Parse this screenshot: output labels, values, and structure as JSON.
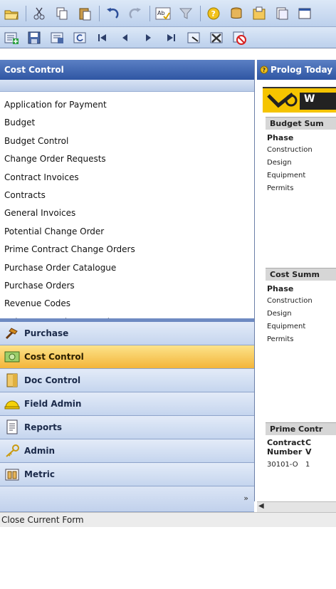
{
  "toolbar1": {
    "icons": [
      "open-folder-icon",
      "cut-icon",
      "copy-icon",
      "paste-icon",
      "undo-icon",
      "redo-icon",
      "spellcheck-icon",
      "filter-icon",
      "help-icon",
      "database-icon",
      "attach-icon",
      "document-icon",
      "window-icon"
    ]
  },
  "toolbar2": {
    "icons": [
      "add-record-icon",
      "save-icon",
      "save-as-icon",
      "refresh-icon",
      "first-record-icon",
      "previous-record-icon",
      "next-record-icon",
      "last-record-icon",
      "find-icon",
      "delete-record-icon",
      "close-form-icon"
    ]
  },
  "left_panel": {
    "title": "Cost Control",
    "items": [
      "Application for Payment",
      "Budget",
      "Budget Control",
      "Change Order Requests",
      "Contract Invoices",
      "Contracts",
      "General Invoices",
      "Potential Change Order",
      "Prime Contract Change Orders",
      "Purchase Order Catalogue",
      "Purchase Orders",
      "Revenue Codes",
      "Subcontract Change Orders"
    ]
  },
  "nav": {
    "buttons": [
      {
        "label": "Purchase",
        "icon": "hammer-icon"
      },
      {
        "label": "Cost Control",
        "icon": "money-icon",
        "active": true
      },
      {
        "label": "Doc Control",
        "icon": "folder-icon"
      },
      {
        "label": "Field Admin",
        "icon": "hardhat-icon"
      },
      {
        "label": "Reports",
        "icon": "report-icon"
      },
      {
        "label": "Admin",
        "icon": "key-icon"
      },
      {
        "label": "Metric",
        "icon": "metric-icon"
      }
    ],
    "footer_chevron": "»"
  },
  "right_panel": {
    "title": "Prolog Today",
    "logo_text": "W",
    "budget": {
      "header": "Budget Sum",
      "col": "Phase",
      "rows": [
        "Construction",
        "Design",
        "Equipment",
        "Permits"
      ]
    },
    "cost": {
      "header": "Cost Summ",
      "col": "Phase",
      "rows": [
        "Construction",
        "Design",
        "Equipment",
        "Permits"
      ]
    },
    "prime": {
      "header": "Prime Contr",
      "col1": "Contract",
      "col1b": "Number",
      "col2": "C",
      "col2b": "V",
      "row_number": "30101-O",
      "row_val": "1"
    }
  },
  "status": {
    "text": "Close Current Form"
  },
  "colors": {
    "header_blue": "#2f56a3",
    "active_nav": "#f3b53a"
  }
}
